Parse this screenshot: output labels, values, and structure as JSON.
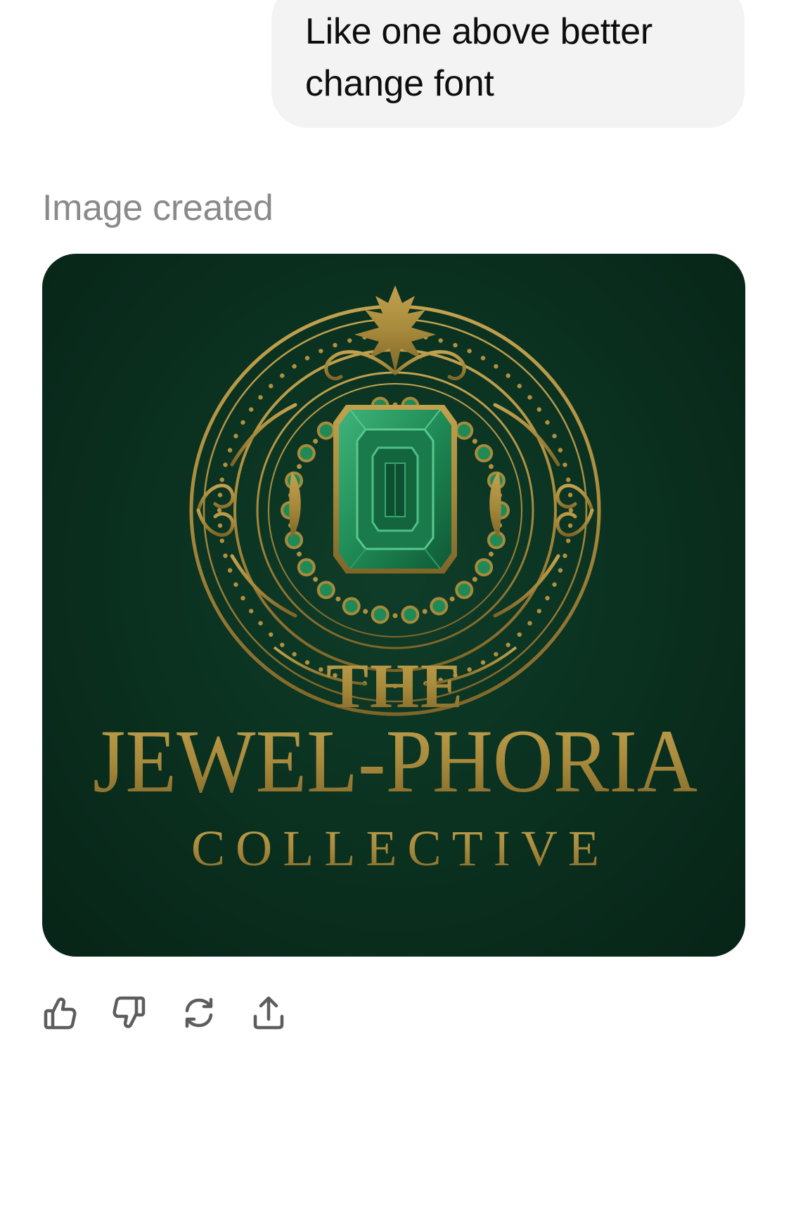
{
  "conversation": {
    "user_message": {
      "line1": "Like one above better",
      "line2": "change font"
    },
    "assistant": {
      "status_label": "Image created",
      "generated_image": {
        "text_the": "THE",
        "text_name": "JEWEL-PHORIA",
        "text_collective": "COLLECTIVE",
        "colors": {
          "background": "#0b3221",
          "gold": "#a88a3c",
          "emerald": "#1f8a55"
        }
      }
    },
    "actions": [
      {
        "icon": "thumbs-up-icon"
      },
      {
        "icon": "thumbs-down-icon"
      },
      {
        "icon": "regenerate-icon"
      },
      {
        "icon": "share-icon"
      }
    ]
  }
}
